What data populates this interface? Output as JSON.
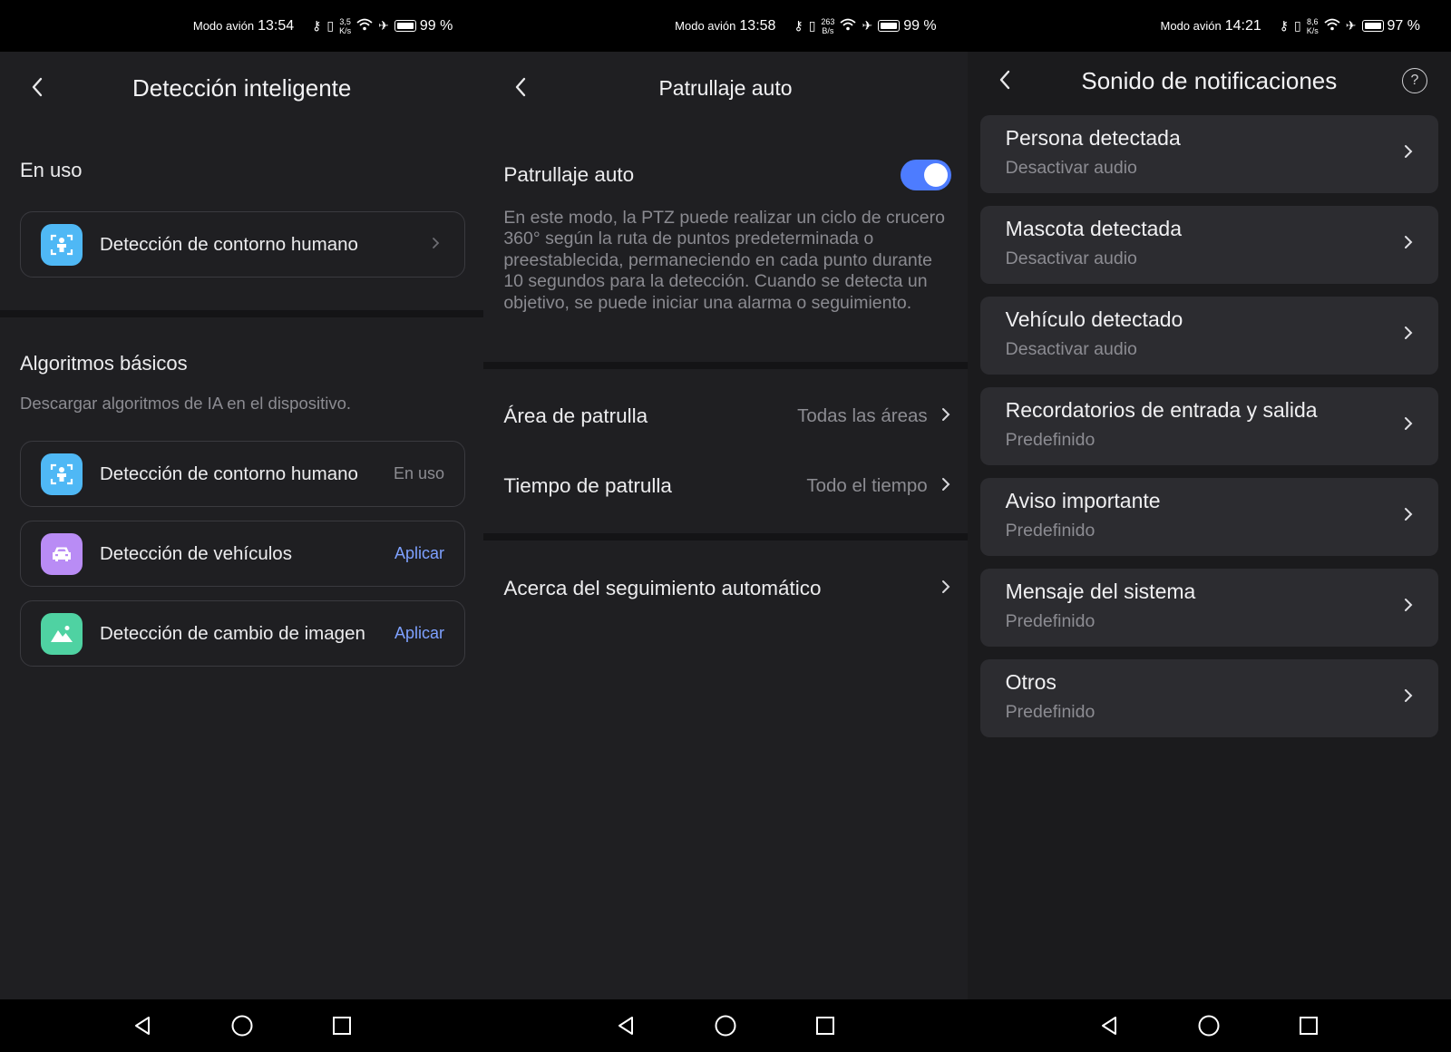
{
  "status_bars": [
    {
      "mode": "Modo avión",
      "time": "13:54",
      "speed_top": "3,5",
      "speed_bottom": "K/s",
      "battery": "99 %"
    },
    {
      "mode": "Modo avión",
      "time": "13:58",
      "speed_top": "263",
      "speed_bottom": "B/s",
      "battery": "99 %"
    },
    {
      "mode": "Modo avión",
      "time": "14:21",
      "speed_top": "8,6",
      "speed_bottom": "K/s",
      "battery": "97 %"
    }
  ],
  "screen1": {
    "title": "Detección inteligente",
    "in_use_label": "En uso",
    "in_use_item": {
      "label": "Detección de contorno humano",
      "icon": "human-contour-icon"
    },
    "basic_label": "Algoritmos básicos",
    "basic_sub": "Descargar algoritmos de IA en el dispositivo.",
    "items": [
      {
        "label": "Detección de contorno humano",
        "status": "En uso",
        "icon": "human-contour-icon",
        "color": "#4fb8f5"
      },
      {
        "label": "Detección de vehículos",
        "status": "Aplicar",
        "icon": "car-icon",
        "color": "#b98cf5"
      },
      {
        "label": "Detección de cambio de imagen",
        "status": "Aplicar",
        "icon": "image-change-icon",
        "color": "#4fd2a2"
      }
    ]
  },
  "screen2": {
    "title": "Patrullaje auto",
    "toggle_label": "Patrullaje auto",
    "toggle_on": true,
    "description": "En este modo, la PTZ puede realizar un ciclo de crucero 360° según la ruta de puntos predeterminada o preestablecida, permaneciendo en cada punto durante 10 segundos para la detección. Cuando se detecta un objetivo, se puede iniciar una alarma o seguimiento.",
    "rows": [
      {
        "label": "Área de patrulla",
        "value": "Todas las áreas"
      },
      {
        "label": "Tiempo de patrulla",
        "value": "Todo el tiempo"
      }
    ],
    "about": "Acerca del seguimiento automático"
  },
  "screen3": {
    "title": "Sonido de notificaciones",
    "items": [
      {
        "title": "Persona detectada",
        "sub": "Desactivar audio"
      },
      {
        "title": "Mascota detectada",
        "sub": "Desactivar audio"
      },
      {
        "title": "Vehículo detectado",
        "sub": "Desactivar audio"
      },
      {
        "title": "Recordatorios de entrada y salida",
        "sub": "Predefinido"
      },
      {
        "title": "Aviso importante",
        "sub": "Predefinido"
      },
      {
        "title": "Mensaje del sistema",
        "sub": "Predefinido"
      },
      {
        "title": "Otros",
        "sub": "Predefinido"
      }
    ]
  },
  "colors": {
    "accent": "#4d7cff",
    "apply_link": "#7ea1ff"
  }
}
